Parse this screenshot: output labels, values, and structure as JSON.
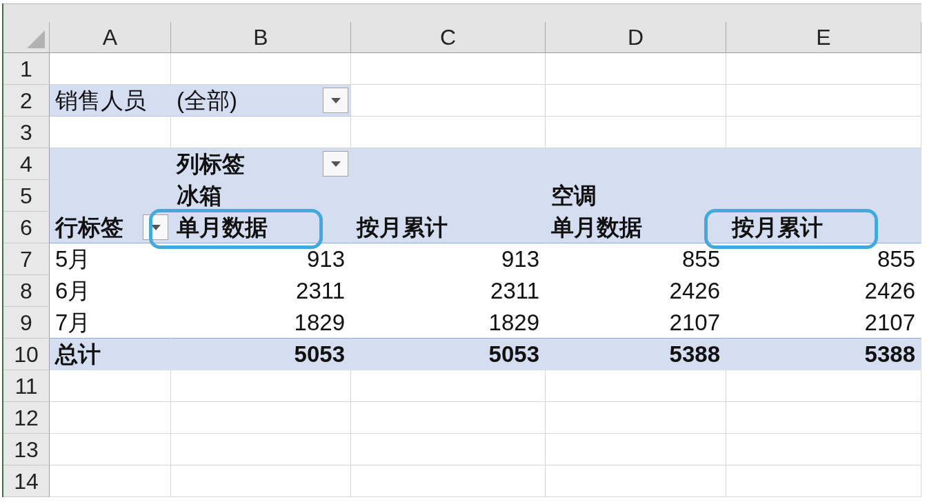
{
  "sheet": {
    "column_headers": [
      "A",
      "B",
      "C",
      "D",
      "E"
    ],
    "row_numbers": [
      "1",
      "2",
      "3",
      "4",
      "5",
      "6",
      "7",
      "8",
      "9",
      "10",
      "11",
      "12",
      "13",
      "14"
    ],
    "report_filter": {
      "field": "销售人员",
      "value": "(全部)"
    },
    "pivot_table": {
      "column_labels_header": "列标签",
      "row_labels_header": "行标签",
      "column_groups": [
        {
          "name": "冰箱",
          "measures": [
            {
              "name": "单月数据",
              "highlighted": true
            },
            {
              "name": "按月累计",
              "highlighted": false
            }
          ]
        },
        {
          "name": "空调",
          "measures": [
            {
              "name": "单月数据",
              "highlighted": false
            },
            {
              "name": "按月累计",
              "highlighted": true
            }
          ]
        }
      ],
      "rows": [
        {
          "label": "5月",
          "values": [
            "913",
            "913",
            "855",
            "855"
          ]
        },
        {
          "label": "6月",
          "values": [
            "2311",
            "2311",
            "2426",
            "2426"
          ]
        },
        {
          "label": "7月",
          "values": [
            "1829",
            "1829",
            "2107",
            "2107"
          ]
        }
      ],
      "grand_total": {
        "label": "总计",
        "values": [
          "5053",
          "5053",
          "5388",
          "5388"
        ]
      }
    }
  }
}
